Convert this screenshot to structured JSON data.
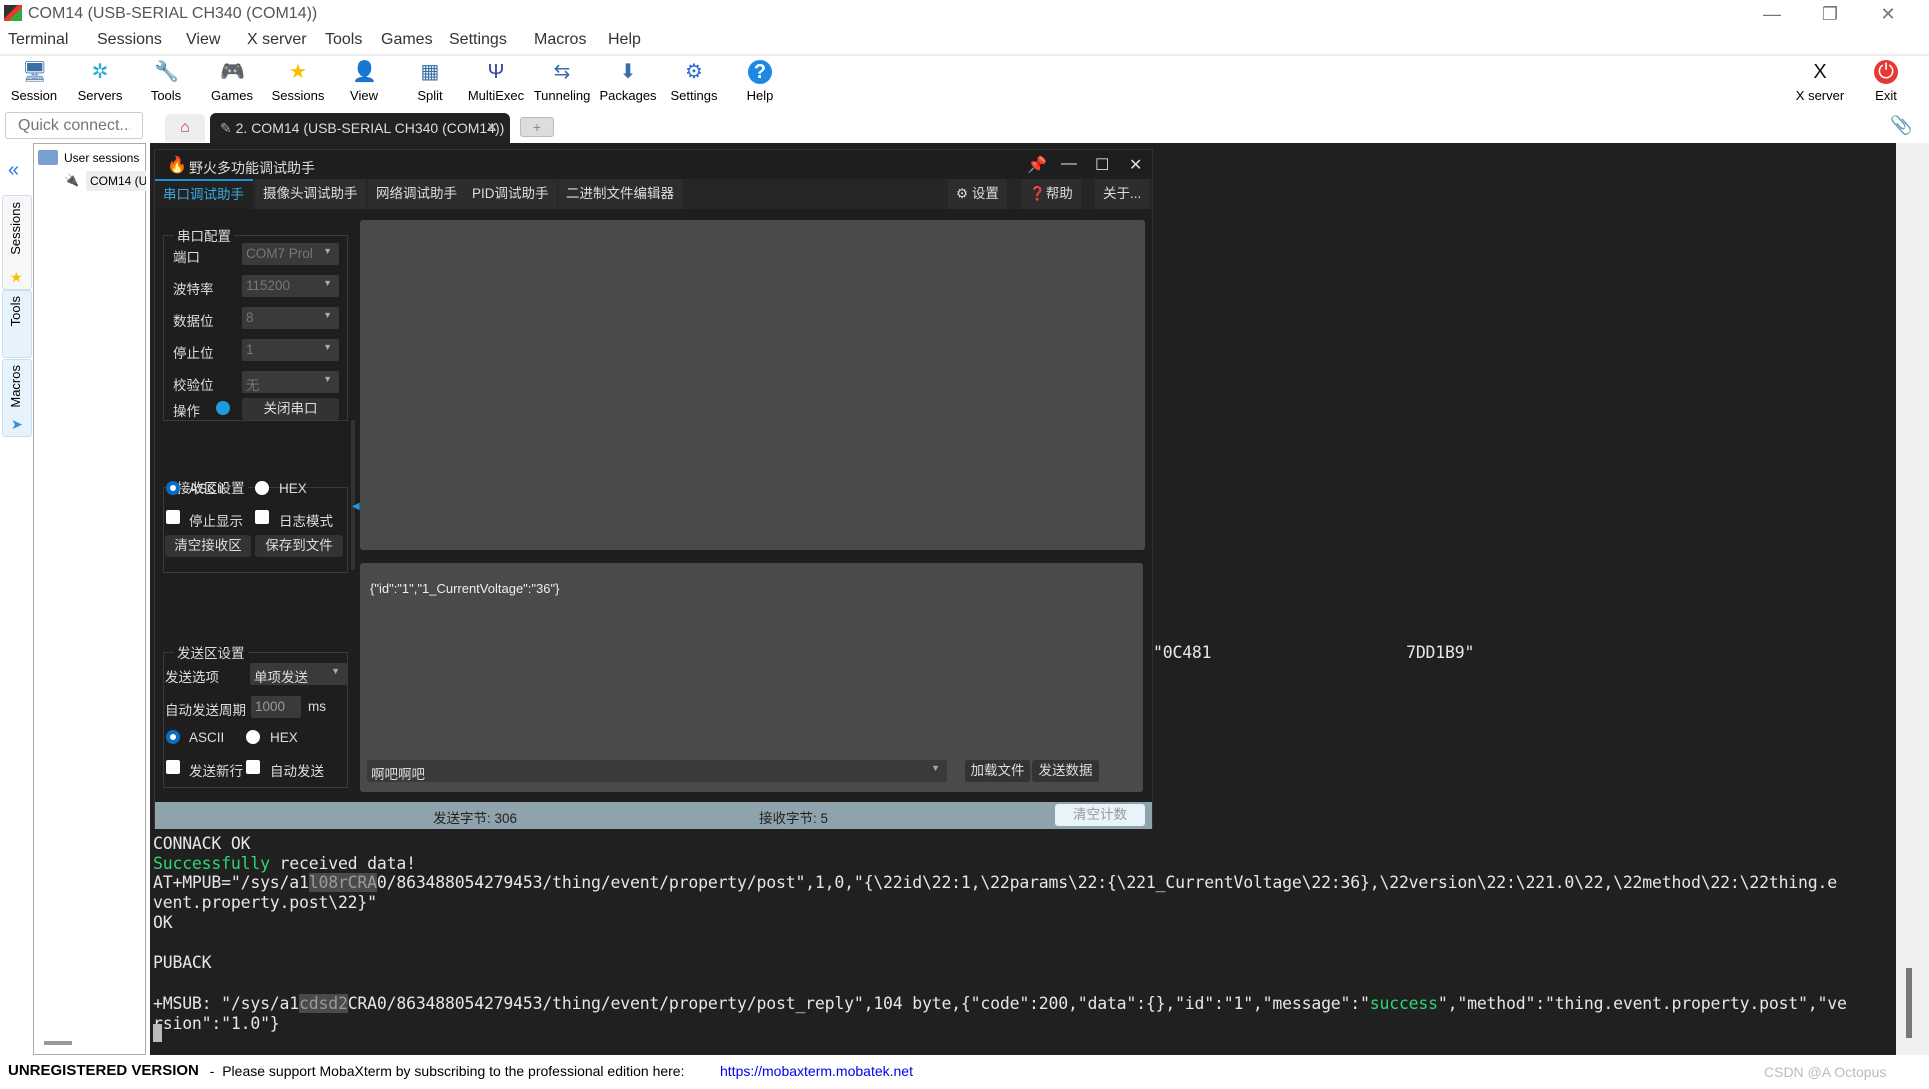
{
  "window": {
    "title": "COM14  (USB-SERIAL CH340 (COM14))"
  },
  "menu": [
    "Terminal",
    "Sessions",
    "View",
    "X server",
    "Tools",
    "Games",
    "Settings",
    "Macros",
    "Help"
  ],
  "toolbar": [
    {
      "label": "Session",
      "icon": "monitor-session-icon"
    },
    {
      "label": "Servers",
      "icon": "servers-icon"
    },
    {
      "label": "Tools",
      "icon": "tools-icon"
    },
    {
      "label": "Games",
      "icon": "gamepad-icon"
    },
    {
      "label": "Sessions",
      "icon": "star-icon"
    },
    {
      "label": "View",
      "icon": "view-icon"
    },
    {
      "label": "Split",
      "icon": "split-icon"
    },
    {
      "label": "MultiExec",
      "icon": "fork-icon"
    },
    {
      "label": "Tunneling",
      "icon": "tunnel-icon"
    },
    {
      "label": "Packages",
      "icon": "package-icon"
    },
    {
      "label": "Settings",
      "icon": "gear-icon"
    },
    {
      "label": "Help",
      "icon": "help-icon"
    }
  ],
  "toolbar_right": [
    {
      "label": "X server",
      "icon": "x-server-icon"
    },
    {
      "label": "Exit",
      "icon": "power-icon"
    }
  ],
  "quick_connect": {
    "placeholder": "Quick connect..."
  },
  "tab": {
    "label": "2. COM14  (USB-SERIAL CH340 (COM14))"
  },
  "side_tabs": [
    "Sessions",
    "Tools",
    "Macros"
  ],
  "sessions_tree": {
    "root": "User sessions",
    "item": "COM14  (USB-SERIAL CH340 (COM14))"
  },
  "app": {
    "title": "野火多功能调试助手",
    "tabs": [
      "串口调试助手",
      "摄像头调试助手",
      "网络调试助手",
      "PID调试助手",
      "二进制文件编辑器"
    ],
    "right_tabs": [
      "设置",
      "帮助",
      "关于..."
    ],
    "serial_config": {
      "legend": "串口配置",
      "fields": [
        {
          "label": "端口",
          "value": "COM7 Prol"
        },
        {
          "label": "波特率",
          "value": "115200"
        },
        {
          "label": "数据位",
          "value": "8"
        },
        {
          "label": "停止位",
          "value": "1"
        },
        {
          "label": "校验位",
          "value": "无"
        }
      ],
      "op_label": "操作",
      "close_button": "关闭串口",
      "status_color": "#1e9be0"
    },
    "recv_settings": {
      "legend": "接收区设置",
      "ascii": "ASCII",
      "hex": "HEX",
      "stop_display": "停止显示",
      "log_mode": "日志模式",
      "clear": "清空接收区",
      "save": "保存到文件"
    },
    "send_settings": {
      "legend": "发送区设置",
      "option_label": "发送选项",
      "option_value": "单项发送",
      "period_label": "自动发送周期",
      "period_value": "1000",
      "period_unit": "ms",
      "ascii": "ASCII",
      "hex": "HEX",
      "newline": "发送新行",
      "auto_send": "自动发送"
    },
    "send_text": "{\"id\":\"1\",\"1_CurrentVoltage\":\"36\"}",
    "send_history": "啊吧啊吧",
    "load_file": "加载文件",
    "send_data": "发送数据",
    "status": {
      "sent": "发送字节: 306",
      "received": "接收字节: 5",
      "clear_count": "清空计数"
    }
  },
  "terminal": {
    "partial_line": "\"0C481                    7DD1B9\"",
    "lines": [
      [
        {
          "t": "CONNACK OK"
        }
      ],
      [
        {
          "t": "Successfully",
          "c": "#2ed573"
        },
        {
          "t": " received data!"
        }
      ],
      [
        {
          "t": "AT+MPUB=\"/sys/a1"
        },
        {
          "t": "l08rCRA",
          "blur": true
        },
        {
          "t": "0/863488054279453/thing/event/property/post\",1,0,\"{\\22id\\22:1,\\22params\\22:{\\221_CurrentVoltage\\22:36},\\22version\\22:\\221.0\\22,\\22method\\22:\\22thing.e"
        }
      ],
      [
        {
          "t": "vent.property.post\\22}\""
        }
      ],
      [
        {
          "t": "OK"
        }
      ],
      [
        {
          "t": ""
        }
      ],
      [
        {
          "t": "PUBACK"
        }
      ],
      [
        {
          "t": ""
        }
      ],
      [
        {
          "t": "+MSUB: \"/sys/a1"
        },
        {
          "t": "cdsd2",
          "blur": true
        },
        {
          "t": "CRA0/863488054279453/thing/event/property/post_reply\",104 byte,{\"code\":200,\"data\":{},\"id\":\"1\",\"message\":\""
        },
        {
          "t": "success",
          "c": "#2ed573"
        },
        {
          "t": "\",\"method\":\"thing.event.property.post\",\"ve"
        }
      ],
      [
        {
          "t": "rsion\":\"1.0\"}"
        }
      ]
    ]
  },
  "statusbar": {
    "unregistered": "UNREGISTERED VERSION",
    "message": "  -  Please support MobaXterm by subscribing to the professional edition here:  ",
    "link": "https://mobaxterm.mobatek.net",
    "watermark": "CSDN @A   Octopus"
  }
}
